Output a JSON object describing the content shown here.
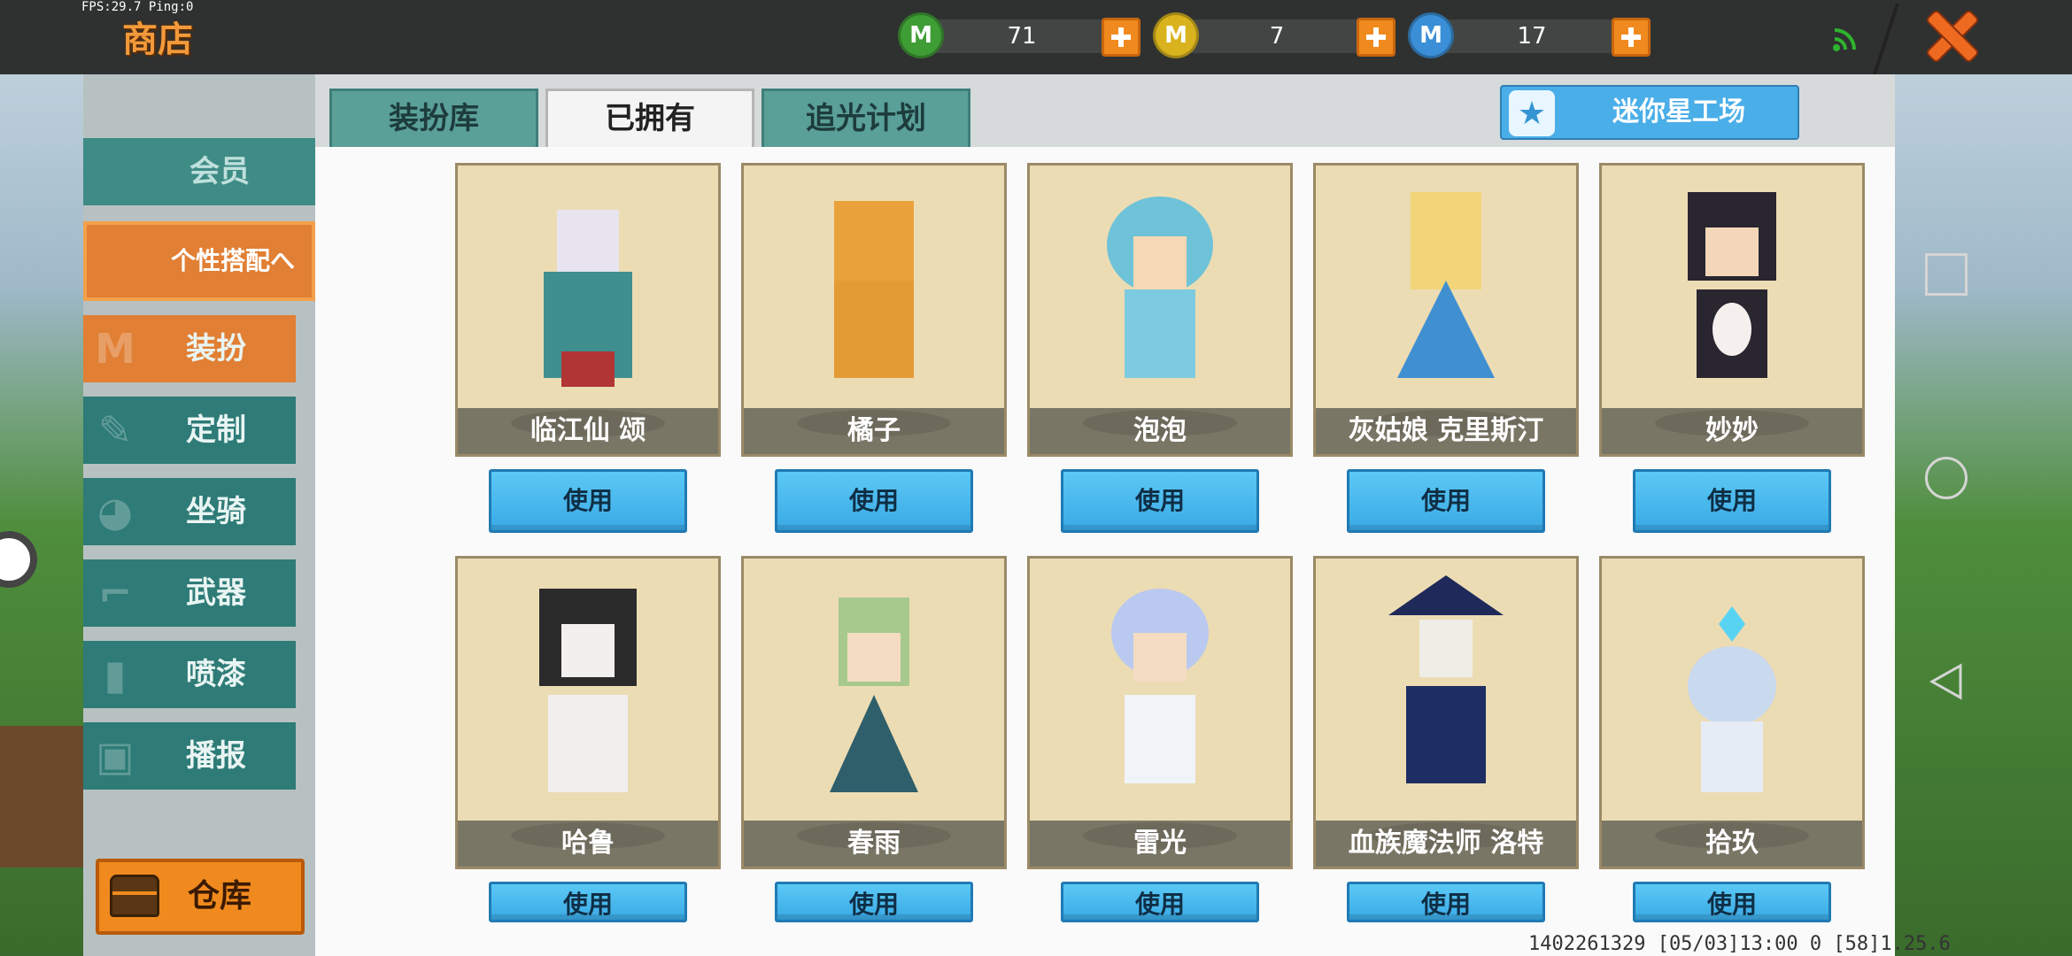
{
  "status": {
    "fps_text": "FPS:29.7  Ping:0"
  },
  "header": {
    "title": "商店"
  },
  "currencies": [
    {
      "icon": "green-m-coin-icon",
      "value": "71",
      "color": "#3f9d35"
    },
    {
      "icon": "gold-m-coin-icon",
      "value": "7",
      "color": "#d8b31e"
    },
    {
      "icon": "blue-m-coin-icon",
      "value": "17",
      "color": "#3a8fd6"
    }
  ],
  "tabs": [
    {
      "label": "装扮库",
      "active": false
    },
    {
      "label": "已拥有",
      "active": true
    },
    {
      "label": "追光计划",
      "active": false
    }
  ],
  "workshop": {
    "label": "迷你星工场"
  },
  "sidebar": {
    "member": "会员",
    "header": "个性搭配へ",
    "items": [
      {
        "label": "装扮",
        "icon": "shirt-icon"
      },
      {
        "label": "定制",
        "icon": "pencil-icon"
      },
      {
        "label": "坐骑",
        "icon": "mount-icon"
      },
      {
        "label": "武器",
        "icon": "gun-icon"
      },
      {
        "label": "喷漆",
        "icon": "spray-can-icon"
      },
      {
        "label": "播报",
        "icon": "broadcast-icon"
      }
    ],
    "warehouse": "仓库"
  },
  "skins": [
    {
      "name": "临江仙 颂",
      "use": "使用"
    },
    {
      "name": "橘子",
      "use": "使用"
    },
    {
      "name": "泡泡",
      "use": "使用"
    },
    {
      "name": "灰姑娘 克里斯汀",
      "use": "使用"
    },
    {
      "name": "妙妙",
      "use": "使用"
    },
    {
      "name": "哈鲁",
      "use": "使用"
    },
    {
      "name": "春雨",
      "use": "使用"
    },
    {
      "name": "雷光",
      "use": "使用"
    },
    {
      "name": "血族魔法师 洛特",
      "use": "使用"
    },
    {
      "name": "拾玖",
      "use": "使用"
    }
  ],
  "footer": {
    "info": "1402261329  [05/03]13:00 0  [58]1.25.6"
  }
}
